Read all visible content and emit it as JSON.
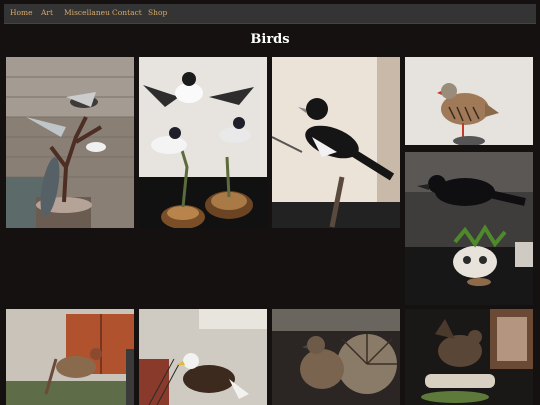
{
  "nav": {
    "items": [
      "Home",
      "Art",
      "Miscellaneu",
      "Contact",
      "Shop"
    ]
  },
  "page": {
    "title": "Birds"
  },
  "gallery": {
    "images": [
      {
        "subject": "canada geese taxidermy on branch"
      },
      {
        "subject": "bufflehead ducks taxidermy"
      },
      {
        "subject": "magpie taxidermy"
      },
      {
        "subject": "partridge taxidermy"
      },
      {
        "subject": "crow taxidermy with skull"
      },
      {
        "subject": "duck taxidermy in hall"
      },
      {
        "subject": "bald eagle taxidermy"
      },
      {
        "subject": "ruffed grouse taxidermy"
      },
      {
        "subject": "grouse taxidermy on log"
      }
    ]
  }
}
